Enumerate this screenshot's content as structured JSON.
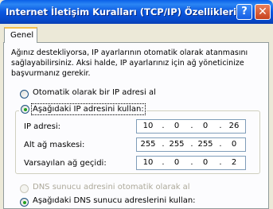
{
  "window": {
    "title": "Internet İletişim Kuralları (TCP/IP) Özellikleri",
    "help_glyph": "?",
    "close_glyph": "✕"
  },
  "tabs": [
    {
      "label": "Genel",
      "selected": true
    }
  ],
  "description": "Ağınız destekliyorsa, IP ayarlarının otomatik olarak atanmasını sağlayabilirsiniz. Aksi halde, IP ayarlarınız için ağ yöneticinize başvurmanız gerekir.",
  "ip_mode": {
    "auto_label": "Otomatik olarak bir IP adresi al",
    "manual_label": "Aşağıdaki IP adresini kullan:",
    "selected": "manual"
  },
  "fields": {
    "ip_address": {
      "label": "IP adresi:",
      "octets": [
        "10",
        "0",
        "0",
        "26"
      ]
    },
    "subnet_mask": {
      "label": "Alt ağ maskesi:",
      "octets": [
        "255",
        "255",
        "255",
        "0"
      ]
    },
    "default_gateway": {
      "label": "Varsayılan ağ geçidi:",
      "octets": [
        "10",
        "0",
        "0",
        "2"
      ]
    }
  },
  "dns_mode": {
    "auto_label": "DNS sunucu adresini otomatik olarak al",
    "manual_label": "Aşağıdaki DNS sunucu adreslerini kullan:",
    "selected": "manual"
  },
  "colors": {
    "titlebar": "#0a57e0",
    "dialog_bg": "#ece9d8",
    "panel_bg": "#fcfcfe",
    "tab_highlight": "#f5c04c",
    "radio_dot": "#21a121",
    "disabled_text": "#aca899"
  },
  "icons": {
    "help": "help-icon",
    "close": "close-icon"
  }
}
